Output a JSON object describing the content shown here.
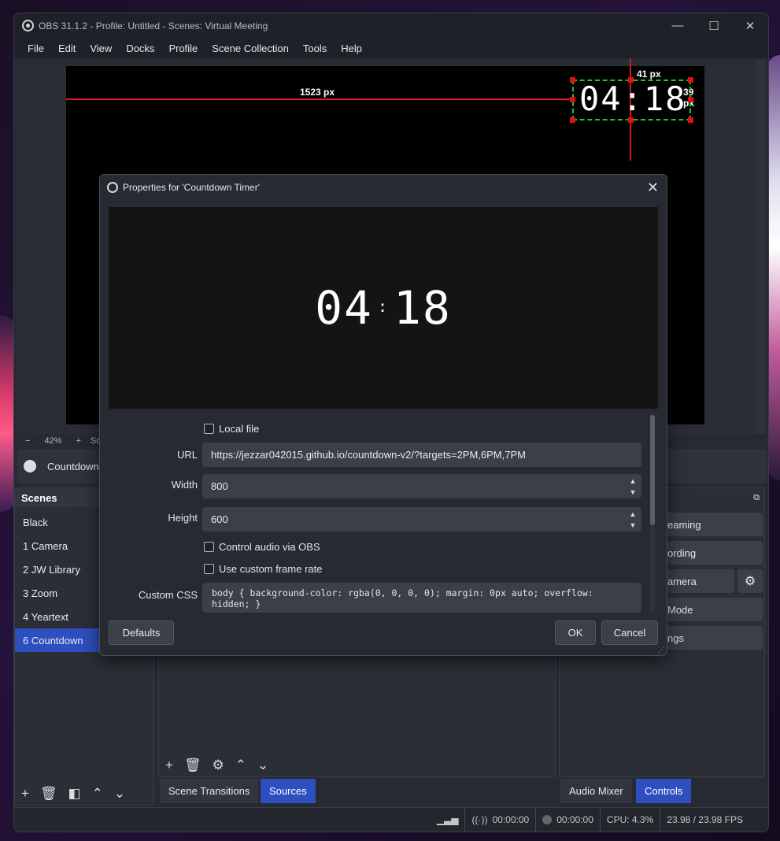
{
  "window": {
    "title": "OBS 31.1.2 - Profile: Untitled - Scenes: Virtual Meeting",
    "controls": {
      "minimize": "—",
      "maximize": "☐",
      "close": "✕"
    }
  },
  "menu": [
    "File",
    "Edit",
    "View",
    "Docks",
    "Profile",
    "Scene Collection",
    "Tools",
    "Help"
  ],
  "preview": {
    "measure_left": "1523 px",
    "measure_top": "41 px",
    "measure_right": "39 px",
    "timer_text": "04:18",
    "zoom": "42%",
    "zoom_minus": "−",
    "zoom_plus": "+",
    "zoom_trunc": "Sc"
  },
  "source_strip": {
    "label": "Countdown"
  },
  "scenes": {
    "header": "Scenes",
    "items": [
      "Black",
      "1 Camera",
      "2 JW Library",
      "3 Zoom",
      "4 Yeartext",
      "6 Countdown"
    ],
    "active_index": 5
  },
  "middle_tabs": {
    "transitions": "Scene Transitions",
    "sources": "Sources"
  },
  "right_tabs": {
    "audio": "Audio Mixer",
    "controls": "Controls"
  },
  "controls": {
    "streaming": "eaming",
    "recording": "ording",
    "camera": "amera",
    "mode": "Mode",
    "settings": "ngs"
  },
  "statusbar": {
    "stream_time": "00:00:00",
    "rec_time": "00:00:00",
    "cpu": "CPU: 4.3%",
    "fps": "23.98 / 23.98 FPS"
  },
  "dialog": {
    "title": "Properties for 'Countdown Timer'",
    "preview_timer": {
      "minutes": "04",
      "seconds": "18"
    },
    "local_file_label": "Local file",
    "url_label": "URL",
    "url_value": "https://jezzar042015.github.io/countdown-v2/?targets=2PM,6PM,7PM",
    "width_label": "Width",
    "width_value": "800",
    "height_label": "Height",
    "height_value": "600",
    "control_audio_label": "Control audio via OBS",
    "custom_fps_label": "Use custom frame rate",
    "custom_css_label": "Custom CSS",
    "custom_css_value": "body { background-color: rgba(0, 0, 0, 0); margin: 0px auto; overflow: hidden; }",
    "defaults_button": "Defaults",
    "ok_button": "OK",
    "cancel_button": "Cancel"
  }
}
